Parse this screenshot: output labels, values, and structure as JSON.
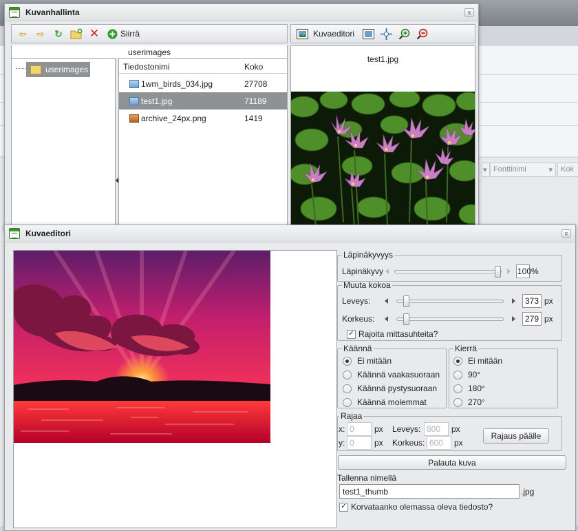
{
  "manager": {
    "title": "Kuvanhallinta",
    "close": "x",
    "toolbar": {
      "move_label": "Siirrä"
    },
    "folder_header": "userimages",
    "folder_item": "userimages",
    "files_header": {
      "name": "Tiedostonimi",
      "size": "Koko"
    },
    "files": [
      {
        "name": "1wm_birds_034.jpg",
        "size": "27708",
        "type": "jpg",
        "selected": false
      },
      {
        "name": "test1.jpg",
        "size": "71189",
        "type": "jpg",
        "selected": true
      },
      {
        "name": "archive_24px.png",
        "size": "1419",
        "type": "png",
        "selected": false
      }
    ],
    "preview": {
      "editor_label": "Kuvaeditori",
      "filename": "test1.jpg"
    }
  },
  "background": {
    "combo_font": "Fonttinimi",
    "combo_size": "Kok"
  },
  "editor": {
    "title": "Kuvaeditori",
    "close": "x",
    "opacity": {
      "legend": "Läpinäkyvyys",
      "label": "Läpinäkyvy",
      "value": "100",
      "unit": "%",
      "level": 1.0
    },
    "resize": {
      "legend": "Muuta kokoa",
      "width_label": "Leveys:",
      "width_value": "373",
      "unit": "px",
      "height_label": "Korkeus:",
      "height_value": "279",
      "keep_ratio_label": "Rajoita mittasuhteita?",
      "keep_ratio_checked": true
    },
    "flip": {
      "legend": "Käännä",
      "options": [
        {
          "label": "Ei mitään",
          "selected": true
        },
        {
          "label": "Käännä vaakasuoraan",
          "selected": false
        },
        {
          "label": "Käännä pystysuoraan",
          "selected": false
        },
        {
          "label": "Käännä molemmat",
          "selected": false
        }
      ]
    },
    "rotate": {
      "legend": "Kierrä",
      "options": [
        {
          "label": "Ei mitään",
          "selected": true
        },
        {
          "label": "90°",
          "selected": false
        },
        {
          "label": "180°",
          "selected": false
        },
        {
          "label": "270°",
          "selected": false
        }
      ]
    },
    "crop": {
      "legend": "Rajaa",
      "x_label": "x:",
      "x_placeholder": "0",
      "y_label": "y:",
      "y_placeholder": "0",
      "unit": "px",
      "width_label": "Leveys:",
      "width_placeholder": "800",
      "height_label": "Korkeus:",
      "height_placeholder": "600",
      "button": "Rajaus päälle"
    },
    "reset_button": "Palauta kuva",
    "save_as_label": "Tallenna nimellä",
    "save_as_value": "test1_thumb",
    "save_as_ext": ".jpg",
    "overwrite_label": "Korvataanko olemassa oleva tiedosto?",
    "overwrite_checked": true
  },
  "colors": {
    "selection": "#8f9295",
    "delete": "#d32020",
    "add": "#2f9a2f"
  }
}
